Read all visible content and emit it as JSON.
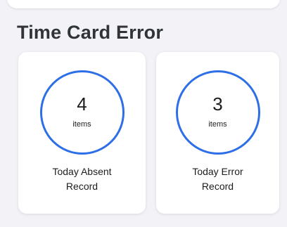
{
  "section": {
    "title": "Time Card Error"
  },
  "cards": [
    {
      "count": "4",
      "unit": "items",
      "label_line1": "Today Absent",
      "label_line2": "Record"
    },
    {
      "count": "3",
      "unit": "items",
      "label_line1": "Today Error",
      "label_line2": "Record"
    }
  ],
  "colors": {
    "ring": "#2e6fe8",
    "background": "#f2f2f7",
    "card": "#ffffff",
    "title": "#303438"
  }
}
